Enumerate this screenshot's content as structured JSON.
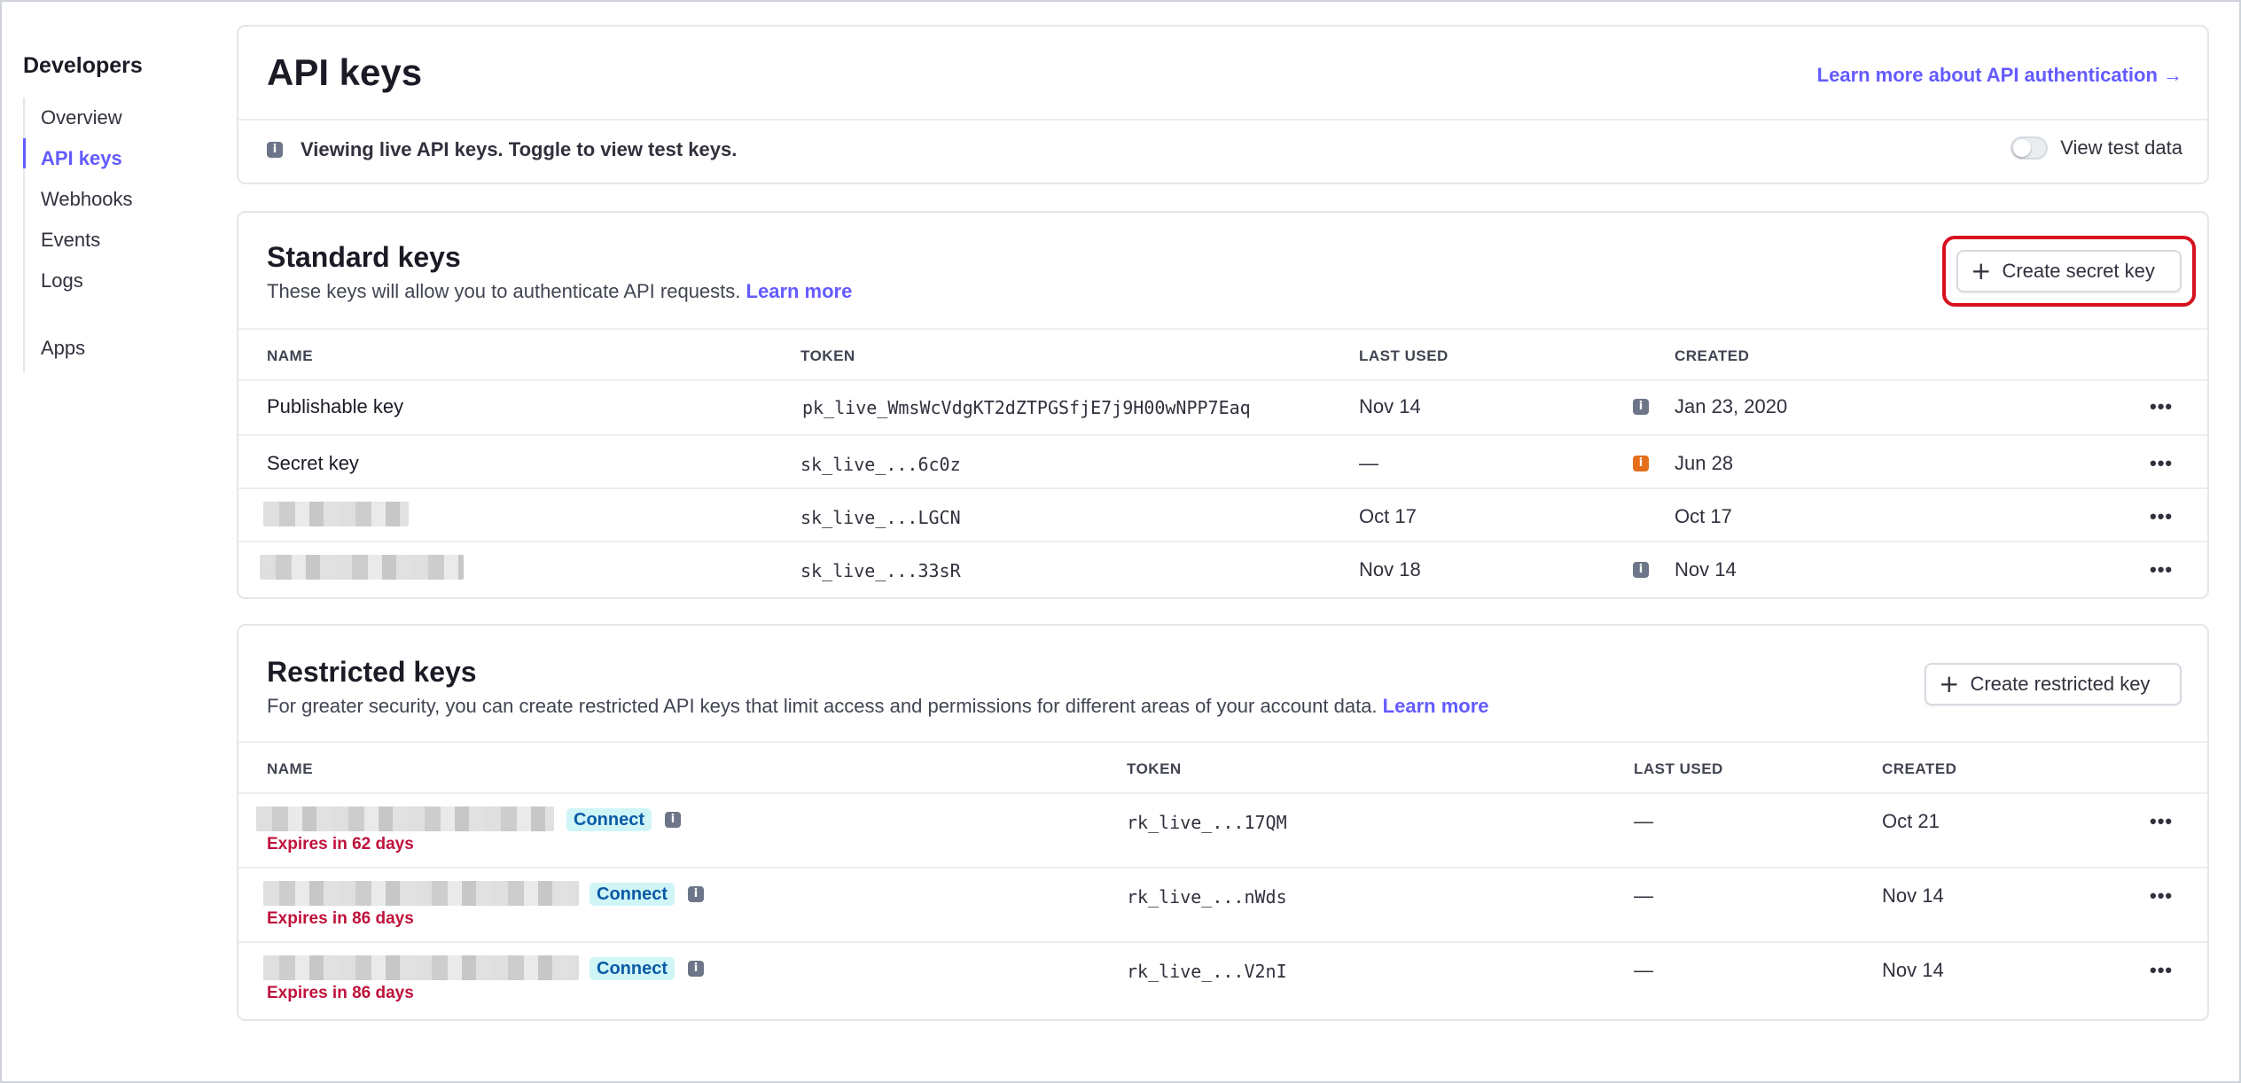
{
  "sidebar": {
    "title": "Developers",
    "items": [
      {
        "label": "Overview"
      },
      {
        "label": "API keys"
      },
      {
        "label": "Webhooks"
      },
      {
        "label": "Events"
      },
      {
        "label": "Logs"
      },
      {
        "label": "Apps"
      }
    ],
    "active_item": "API keys"
  },
  "header": {
    "title": "API keys",
    "learn_more_link": "Learn more about API authentication →",
    "info_icon": "info-icon",
    "notice": "Viewing live API keys. Toggle to view test keys.",
    "toggle_label": "View test data",
    "toggle_on": false
  },
  "standard_keys": {
    "title": "Standard keys",
    "description": "These keys will allow you to authenticate API requests.",
    "learn_more": "Learn more",
    "create_button": "Create secret key",
    "columns": {
      "name": "NAME",
      "token": "TOKEN",
      "last_used": "LAST USED",
      "created": "CREATED"
    },
    "rows": [
      {
        "name": "Publishable key",
        "token": "pk_live_WmsWcVdgKT2dZTPGSfjE7j9H00wNPP7Eaq",
        "last_used": "Nov 14",
        "info_icon": "gray",
        "created": "Jan 23, 2020"
      },
      {
        "name": "Secret key",
        "token": "sk_live_...6c0z",
        "last_used": "—",
        "info_icon": "orange",
        "created": "Jun 28"
      },
      {
        "name": "",
        "token": "sk_live_...LGCN",
        "last_used": "Oct 17",
        "info_icon": "",
        "created": "Oct 17"
      },
      {
        "name": "",
        "token": "sk_live_...33sR",
        "last_used": "Nov 18",
        "info_icon": "gray",
        "created": "Nov 14"
      }
    ]
  },
  "restricted_keys": {
    "title": "Restricted keys",
    "description": "For greater security, you can create restricted API keys that limit access and permissions for different areas of your account data.",
    "learn_more": "Learn more",
    "create_button": "Create restricted key",
    "columns": {
      "name": "NAME",
      "token": "TOKEN",
      "last_used": "LAST USED",
      "created": "CREATED"
    },
    "rows": [
      {
        "badge": "Connect",
        "expires": "Expires in 62 days",
        "token": "rk_live_...17QM",
        "last_used": "—",
        "created": "Oct 21"
      },
      {
        "badge": "Connect",
        "expires": "Expires in 86 days",
        "token": "rk_live_...nWds",
        "last_used": "—",
        "created": "Nov 14"
      },
      {
        "badge": "Connect",
        "expires": "Expires in 86 days",
        "token": "rk_live_...V2nI",
        "last_used": "—",
        "created": "Nov 14"
      }
    ]
  },
  "colors": {
    "accent": "#635bff",
    "highlight": "#d6101e",
    "expires": "#c0123c",
    "badge_bg": "#cff5f6"
  }
}
